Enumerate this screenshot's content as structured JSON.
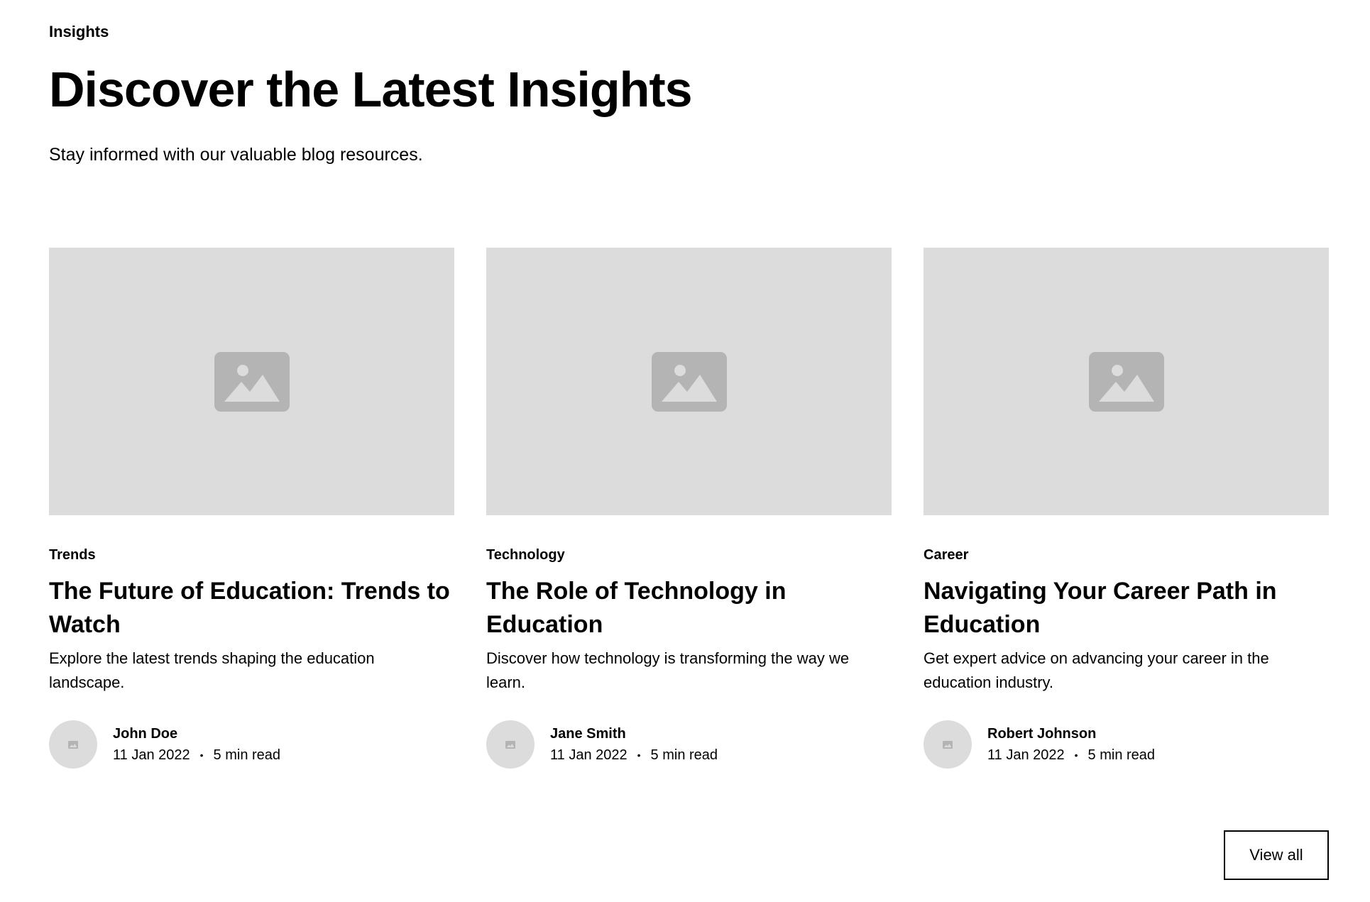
{
  "header": {
    "eyebrow": "Insights",
    "title": "Discover the Latest Insights",
    "subtitle": "Stay informed with our valuable blog resources."
  },
  "cards": [
    {
      "image_icon": "image-placeholder-icon",
      "category": "Trends",
      "title": "The Future of Education: Trends to Watch",
      "excerpt": "Explore the latest trends shaping the education landscape.",
      "author": "John Doe",
      "date": "11 Jan 2022",
      "separator": "•",
      "read_time": "5 min read"
    },
    {
      "image_icon": "image-placeholder-icon",
      "category": "Technology",
      "title": "The Role of Technology in Education",
      "excerpt": "Discover how technology is transforming the way we learn.",
      "author": "Jane Smith",
      "date": "11 Jan 2022",
      "separator": "•",
      "read_time": "5 min read"
    },
    {
      "image_icon": "image-placeholder-icon",
      "category": "Career",
      "title": "Navigating Your Career Path in Education",
      "excerpt": "Get expert advice on advancing your career in the education industry.",
      "author": "Robert Johnson",
      "date": "11 Jan 2022",
      "separator": "•",
      "read_time": "5 min read"
    }
  ],
  "actions": {
    "view_all_label": "View all"
  },
  "colors": {
    "placeholder_bg": "#dcdcdc",
    "placeholder_icon": "#b4b4b4",
    "text": "#000000",
    "background": "#ffffff"
  }
}
